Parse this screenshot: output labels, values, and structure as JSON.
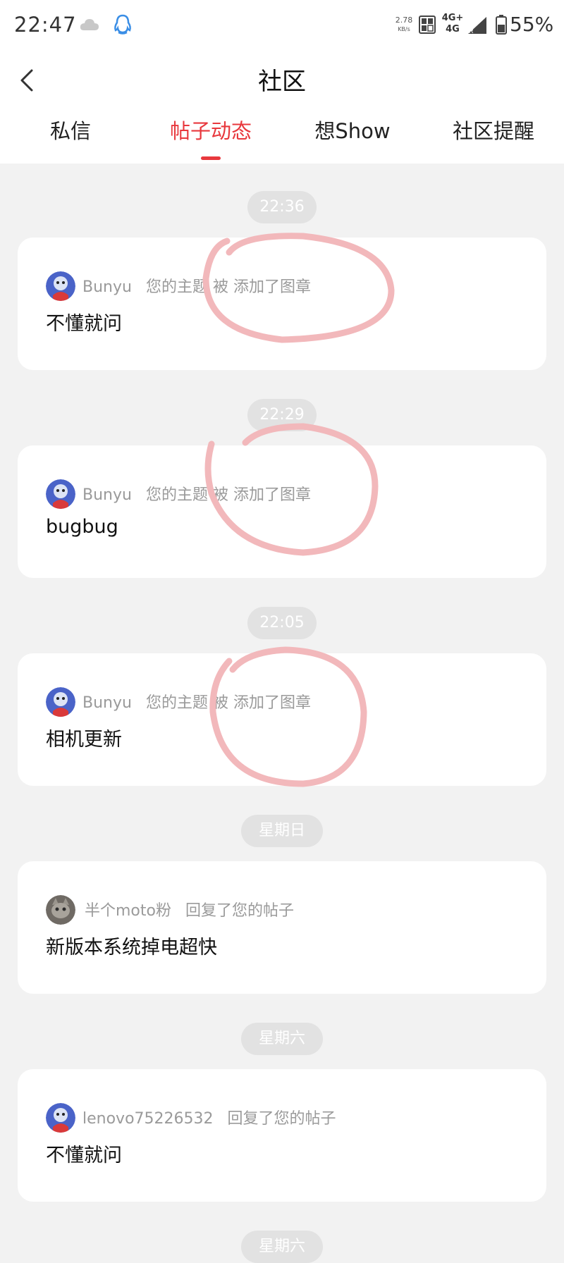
{
  "status_bar": {
    "time": "22:47",
    "net_speed_value": "2.78",
    "net_speed_unit": "KB/s",
    "net_type_top": "4G+",
    "net_type_bottom": "4G",
    "battery": "55%"
  },
  "header": {
    "title": "社区"
  },
  "tabs": [
    {
      "label": "私信",
      "active": false
    },
    {
      "label": "帖子动态",
      "active": true
    },
    {
      "label": "想Show",
      "active": false
    },
    {
      "label": "社区提醒",
      "active": false
    }
  ],
  "feed": [
    {
      "time": "22:36",
      "user": "Bunyu",
      "action": "您的主题 被 添加了图章",
      "title": "不懂就问",
      "avatar": "mascot-avatar"
    },
    {
      "time": "22:29",
      "user": "Bunyu",
      "action": "您的主题 被 添加了图章",
      "title": "bugbug",
      "avatar": "mascot-avatar"
    },
    {
      "time": "22:05",
      "user": "Bunyu",
      "action": "您的主题 被 添加了图章",
      "title": "相机更新",
      "avatar": "mascot-avatar"
    },
    {
      "time": "星期日",
      "user": "半个moto粉",
      "action": "回复了您的帖子",
      "title": "新版本系统掉电超快",
      "avatar": "cat-avatar"
    },
    {
      "time": "星期六",
      "user": "lenovo75226532",
      "action": "回复了您的帖子",
      "title": "不懂就问",
      "avatar": "mascot-avatar"
    },
    {
      "time": "星期六"
    }
  ],
  "colors": {
    "accent": "#e8383d",
    "annotation": "#f2b8bb"
  }
}
